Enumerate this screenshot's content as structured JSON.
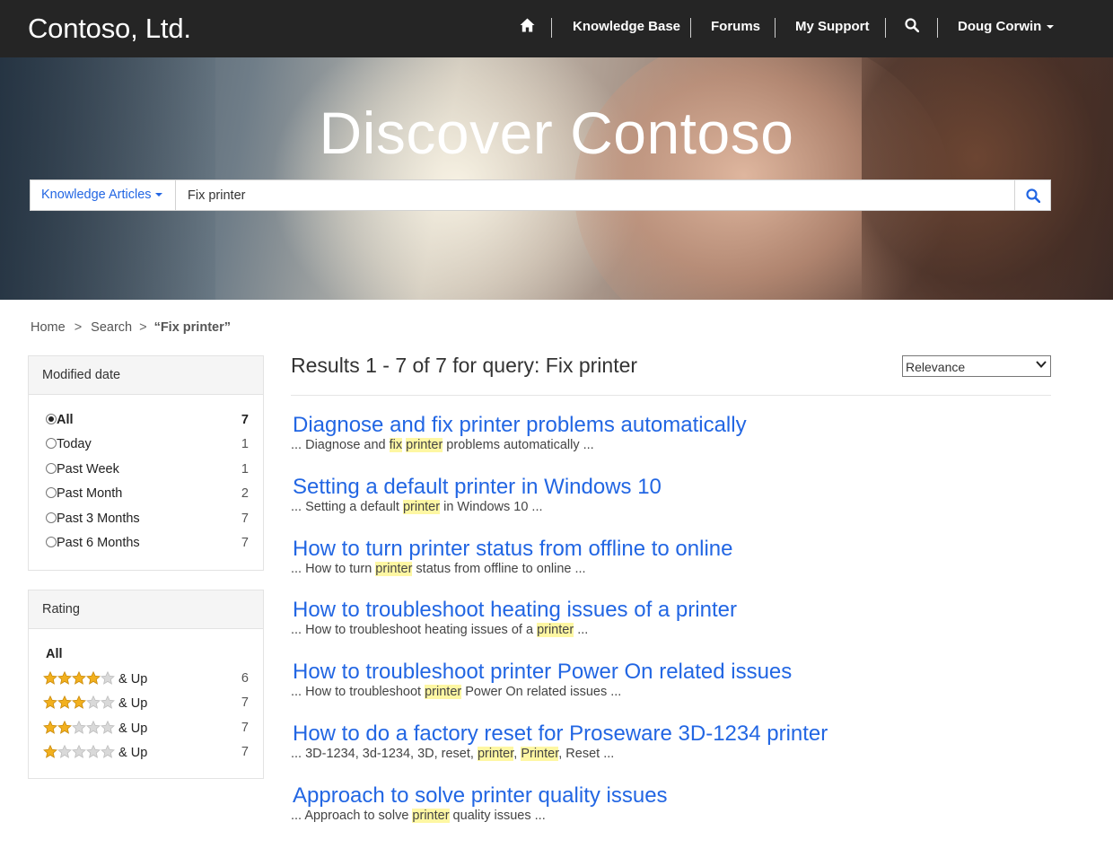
{
  "brand": "Contoso, Ltd.",
  "nav": {
    "home_icon": "home-icon",
    "knowledge_base": "Knowledge Base",
    "forums": "Forums",
    "my_support": "My Support",
    "search_icon": "search-icon",
    "user": "Doug Corwin"
  },
  "hero": {
    "title": "Discover Contoso"
  },
  "search": {
    "scope": "Knowledge Articles",
    "query": "Fix printer",
    "button_icon": "search-icon"
  },
  "breadcrumb": {
    "home": "Home",
    "sep": ">",
    "search": "Search",
    "current": "“Fix printer”"
  },
  "facets": {
    "modified": {
      "title": "Modified date",
      "items": [
        {
          "label": "All",
          "count": "7",
          "selected": true
        },
        {
          "label": "Today",
          "count": "1",
          "selected": false
        },
        {
          "label": "Past Week",
          "count": "1",
          "selected": false
        },
        {
          "label": "Past Month",
          "count": "2",
          "selected": false
        },
        {
          "label": "Past 3 Months",
          "count": "7",
          "selected": false
        },
        {
          "label": "Past 6 Months",
          "count": "7",
          "selected": false
        }
      ]
    },
    "rating": {
      "title": "Rating",
      "all": "All",
      "suffix": "& Up",
      "items": [
        {
          "stars": 4,
          "count": "6"
        },
        {
          "stars": 3,
          "count": "7"
        },
        {
          "stars": 2,
          "count": "7"
        },
        {
          "stars": 1,
          "count": "7"
        }
      ]
    }
  },
  "results": {
    "summary": "Results 1 - 7 of 7 for query: Fix printer",
    "sort": "Relevance",
    "items": [
      {
        "title": "Diagnose and fix printer problems automatically",
        "snippet": [
          {
            "t": "... Diagnose and "
          },
          {
            "t": "fix",
            "h": true
          },
          {
            "t": " "
          },
          {
            "t": "printer",
            "h": true
          },
          {
            "t": " problems automatically ..."
          }
        ]
      },
      {
        "title": "Setting a default printer in Windows 10",
        "snippet": [
          {
            "t": "... Setting a default "
          },
          {
            "t": "printer",
            "h": true
          },
          {
            "t": " in Windows 10 ..."
          }
        ]
      },
      {
        "title": "How to turn printer status from offline to online",
        "snippet": [
          {
            "t": "... How to turn "
          },
          {
            "t": "printer",
            "h": true
          },
          {
            "t": " status from offline to online ..."
          }
        ]
      },
      {
        "title": "How to troubleshoot heating issues of a printer",
        "snippet": [
          {
            "t": "... How to troubleshoot heating issues of a "
          },
          {
            "t": "printer",
            "h": true
          },
          {
            "t": " ..."
          }
        ]
      },
      {
        "title": "How to troubleshoot printer Power On related issues",
        "snippet": [
          {
            "t": "... How to troubleshoot "
          },
          {
            "t": "printer",
            "h": true
          },
          {
            "t": " Power On related issues ..."
          }
        ]
      },
      {
        "title": "How to do a factory reset for Proseware 3D-1234 printer",
        "snippet": [
          {
            "t": "... 3D-1234, 3d-1234, 3D, reset, "
          },
          {
            "t": "printer",
            "h": true
          },
          {
            "t": ", "
          },
          {
            "t": "Printer",
            "h": true
          },
          {
            "t": ", Reset ..."
          }
        ]
      },
      {
        "title": "Approach to solve printer quality issues",
        "snippet": [
          {
            "t": "... Approach to solve "
          },
          {
            "t": "printer",
            "h": true
          },
          {
            "t": " quality issues ..."
          }
        ]
      }
    ]
  },
  "colors": {
    "navbar": "#252525",
    "link": "#2266e3",
    "highlight": "#fef7a3",
    "star_on": "#f2b01e",
    "star_off": "#d9d9d9"
  }
}
